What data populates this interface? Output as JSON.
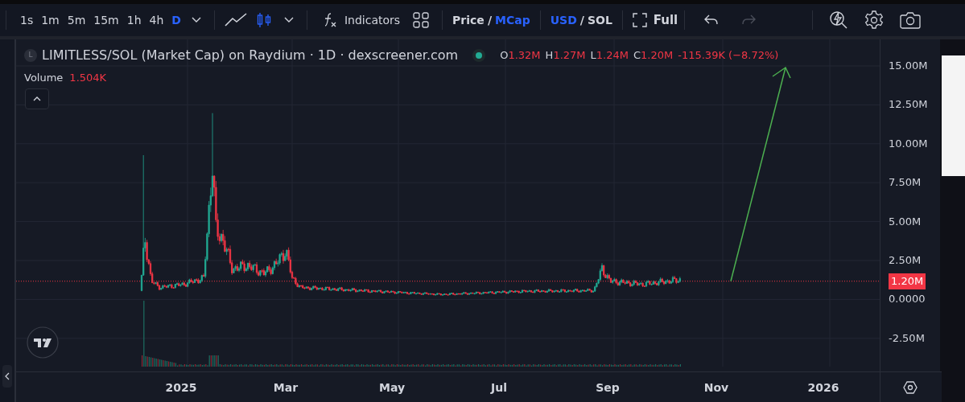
{
  "toolbar": {
    "intervals": [
      {
        "label": "1s",
        "selected": false
      },
      {
        "label": "1m",
        "selected": false
      },
      {
        "label": "5m",
        "selected": false
      },
      {
        "label": "15m",
        "selected": false
      },
      {
        "label": "1h",
        "selected": false
      },
      {
        "label": "4h",
        "selected": false
      },
      {
        "label": "D",
        "selected": true
      }
    ],
    "chart_types": [
      {
        "kind": "line",
        "selected": false
      },
      {
        "kind": "candles",
        "selected": true
      }
    ],
    "indicators": "Indicators",
    "value_mode": {
      "separator": "/",
      "options": [
        {
          "label": "Price",
          "selected": false
        },
        {
          "label": "MCap",
          "selected": true
        }
      ]
    },
    "currency": {
      "separator": "/",
      "options": [
        {
          "label": "USD",
          "selected": true
        },
        {
          "label": "SOL",
          "selected": false
        }
      ]
    },
    "fullscreen": "Full",
    "redo_disabled": true
  },
  "legend": {
    "symbol_initial": "L",
    "title": "LIMITLESS/SOL (Market Cap) on Raydium · 1D · dexscreener.com",
    "ohlc": [
      {
        "key": "O",
        "value": "1.32M"
      },
      {
        "key": "H",
        "value": "1.27M"
      },
      {
        "key": "L",
        "value": "1.24M"
      },
      {
        "key": "C",
        "value": "1.20M"
      }
    ],
    "change": "-115.39K (−8.72%)",
    "volume_label": "Volume",
    "volume_value": "1.504K"
  },
  "price_axis": {
    "ticks": [
      "15.00M",
      "12.50M",
      "10.00M",
      "7.50M",
      "5.00M",
      "2.50M",
      "0.0000",
      "-2.50M"
    ],
    "current_price": "1.20M"
  },
  "time_axis": {
    "labels": [
      "2025",
      "Mar",
      "May",
      "Jul",
      "Sep",
      "Nov",
      "2026"
    ]
  }
}
